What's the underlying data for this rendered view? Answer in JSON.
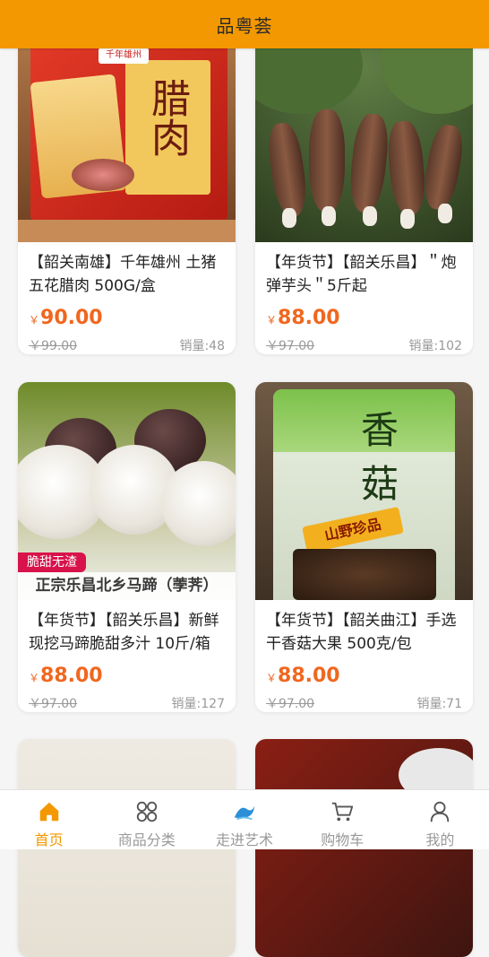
{
  "header": {
    "title": "品粤荟"
  },
  "products": [
    {
      "title": "【韶关南雄】千年雄州 土猪五花腊肉 500G/盒",
      "currency": "￥",
      "price": "90.00",
      "original_price": "￥99.00",
      "sales": "销量:48",
      "image": {
        "brand": "千年雄州",
        "char": "腊肉"
      }
    },
    {
      "title": "【年货节】【韶关乐昌】＂炮弹芋头＂5斤起",
      "currency": "￥",
      "price": "88.00",
      "original_price": "￥97.00",
      "sales": "销量:102"
    },
    {
      "title": "【年货节】【韶关乐昌】新鲜现挖马蹄脆甜多汁 10斤/箱",
      "currency": "￥",
      "price": "88.00",
      "original_price": "￥97.00",
      "sales": "销量:127",
      "image": {
        "tag": "脆甜无渣",
        "caption": "正宗乐昌北乡马蹄（荸荠）"
      }
    },
    {
      "title": "【年货节】【韶关曲江】手选干香菇大果 500克/包",
      "currency": "￥",
      "price": "88.00",
      "original_price": "￥97.00",
      "sales": "销量:71",
      "image": {
        "char1": "香",
        "char2": "菇",
        "label": "山野珍品"
      }
    }
  ],
  "tabbar": [
    {
      "label": "首页",
      "icon": "home-icon",
      "active": true
    },
    {
      "label": "商品分类",
      "icon": "category-icon",
      "active": false
    },
    {
      "label": "走进艺术",
      "icon": "art-logo-icon",
      "active": false
    },
    {
      "label": "购物车",
      "icon": "cart-icon",
      "active": false
    },
    {
      "label": "我的",
      "icon": "user-icon",
      "active": false
    }
  ],
  "colors": {
    "brand": "#f39800",
    "price": "#f0671f"
  }
}
